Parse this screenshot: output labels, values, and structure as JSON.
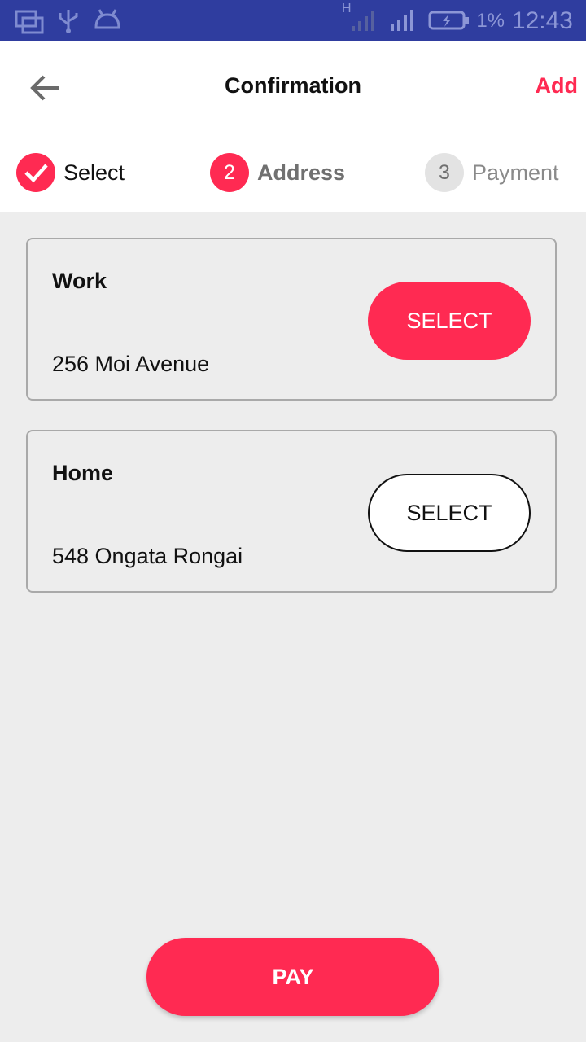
{
  "status_bar": {
    "battery_percent": "1%",
    "time": "12:43",
    "network_type": "H",
    "icons": [
      "screen-mirror-icon",
      "usb-icon",
      "android-icon",
      "signal-icon",
      "battery-charging-icon"
    ]
  },
  "header": {
    "title": "Confirmation",
    "add_label": "Add",
    "back_icon": "arrow-left-icon"
  },
  "stepper": {
    "steps": [
      {
        "number": "",
        "label": "Select",
        "state": "done"
      },
      {
        "number": "2",
        "label": "Address",
        "state": "active"
      },
      {
        "number": "3",
        "label": "Payment",
        "state": "pending"
      }
    ]
  },
  "addresses": [
    {
      "name": "Work",
      "address": "256 Moi Avenue",
      "button_label": "SELECT",
      "selected": true
    },
    {
      "name": "Home",
      "address": "548 Ongata Rongai",
      "button_label": "SELECT",
      "selected": false
    }
  ],
  "pay_label": "PAY",
  "colors": {
    "accent": "#ff2a52",
    "status_bar": "#2f3d9f",
    "background": "#ededed"
  }
}
